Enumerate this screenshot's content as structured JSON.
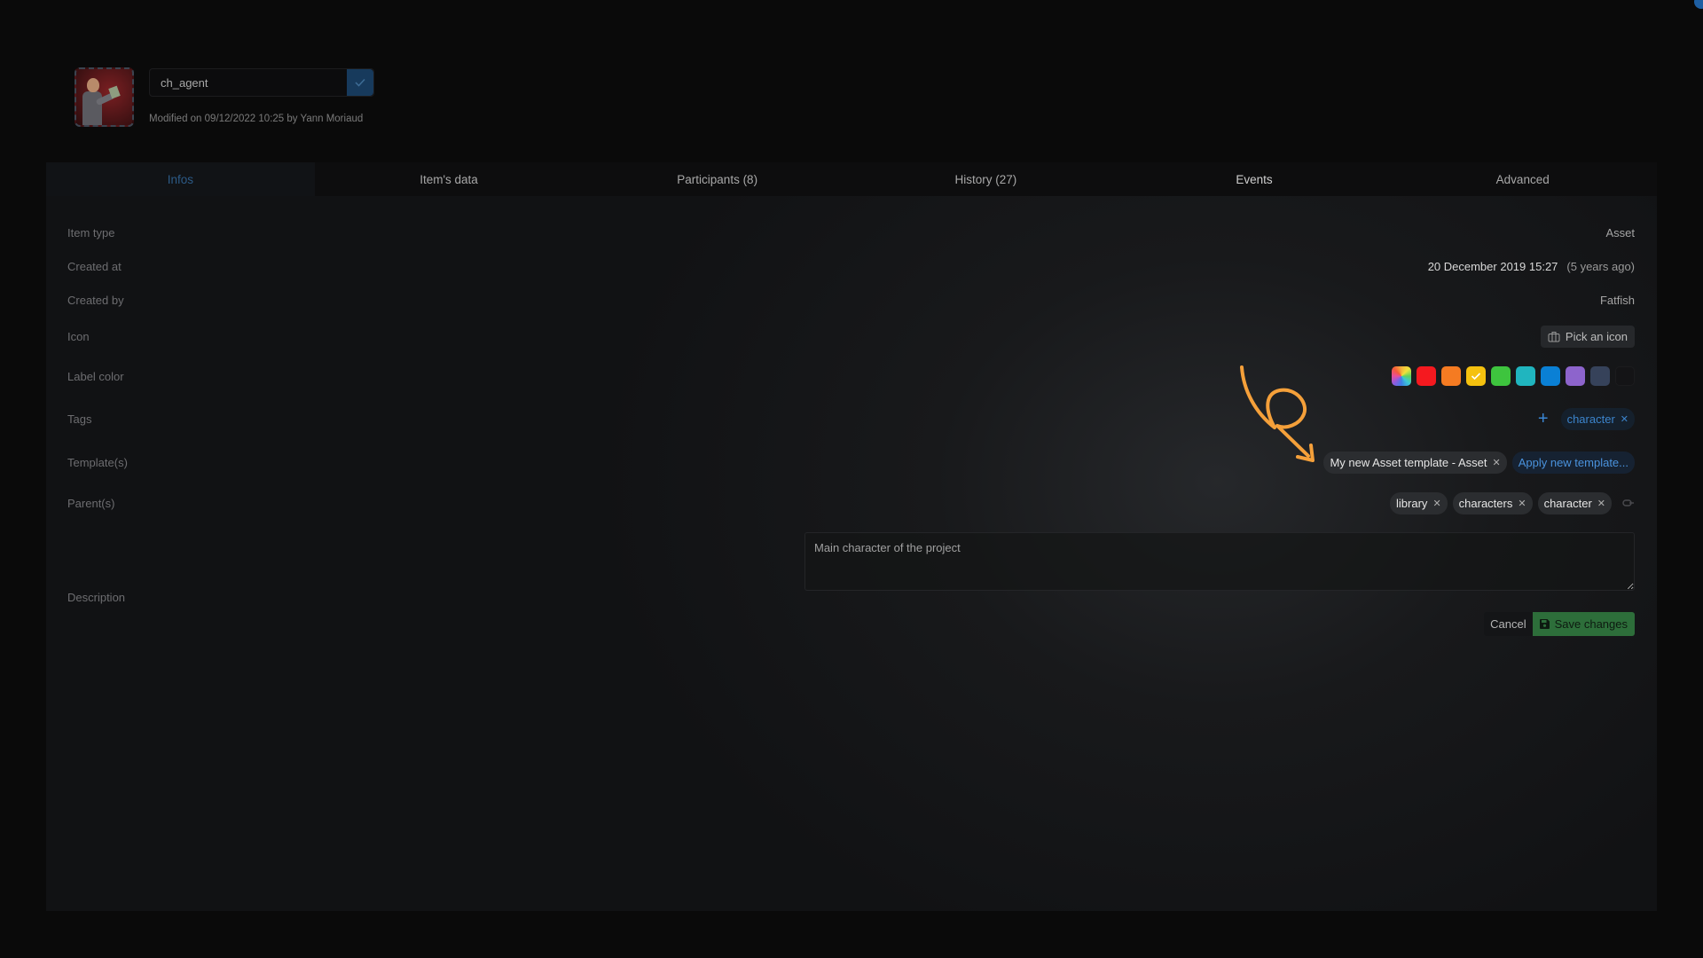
{
  "header": {
    "name_value": "ch_agent",
    "modified_text": "Modified on 09/12/2022 10:25 by Yann Moriaud",
    "avatar_alt": "ch_agent thumbnail"
  },
  "tabs": [
    {
      "label": "Infos",
      "active": true
    },
    {
      "label": "Item's data",
      "active": false
    },
    {
      "label": "Participants (8)",
      "active": false
    },
    {
      "label": "History (27)",
      "active": false
    },
    {
      "label": "Events",
      "active": false
    },
    {
      "label": "Advanced",
      "active": false
    }
  ],
  "fields": {
    "item_type": {
      "label": "Item type",
      "value": "Asset"
    },
    "created_at": {
      "label": "Created at",
      "value": "20 December 2019 15:27",
      "relative": "(5 years ago)"
    },
    "created_by": {
      "label": "Created by",
      "value": "Fatfish"
    },
    "icon": {
      "label": "Icon",
      "button": "Pick an icon"
    },
    "label_color": {
      "label": "Label color",
      "swatches": [
        {
          "name": "rainbow",
          "color": "conic"
        },
        {
          "name": "red",
          "color": "#f5191f"
        },
        {
          "name": "orange",
          "color": "#f57b22"
        },
        {
          "name": "yellow",
          "color": "#f5c10f",
          "selected": true
        },
        {
          "name": "green",
          "color": "#3ec43e"
        },
        {
          "name": "teal",
          "color": "#20b5bf"
        },
        {
          "name": "blue",
          "color": "#0a80d5"
        },
        {
          "name": "purple",
          "color": "#8d64cc"
        },
        {
          "name": "slate",
          "color": "#36425a"
        },
        {
          "name": "black",
          "color": "#141416"
        }
      ]
    },
    "tags": {
      "label": "Tags",
      "items": [
        "character"
      ]
    },
    "templates": {
      "label": "Template(s)",
      "items": [
        "My new Asset template - Asset"
      ],
      "apply_button": "Apply new template..."
    },
    "parents": {
      "label": "Parent(s)",
      "items": [
        "library",
        "characters",
        "character"
      ]
    },
    "description": {
      "label": "Description",
      "value": "Main character of the project"
    }
  },
  "actions": {
    "cancel": "Cancel",
    "save": "Save changes"
  },
  "colors": {
    "accent": "#3a86d4",
    "annotation": "#f5a03a",
    "save_green": "#2d6e3a"
  }
}
